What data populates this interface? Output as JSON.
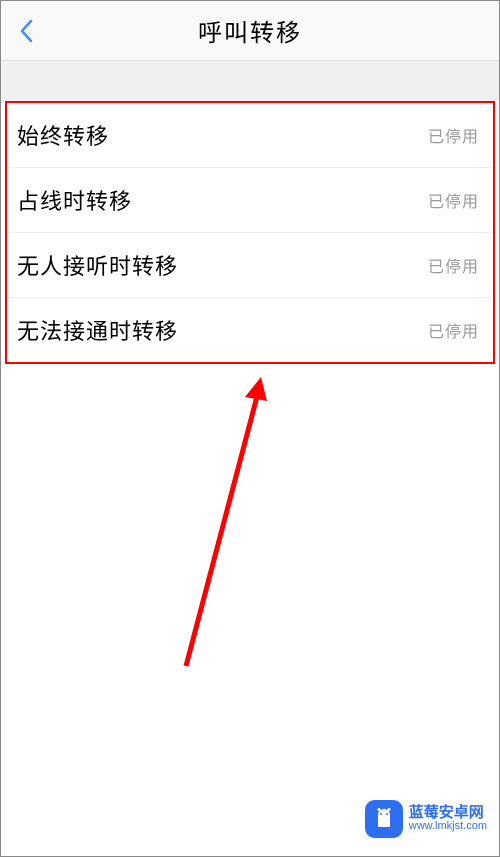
{
  "header": {
    "title": "呼叫转移"
  },
  "options": [
    {
      "label": "始终转移",
      "status": "已停用"
    },
    {
      "label": "占线时转移",
      "status": "已停用"
    },
    {
      "label": "无人接听时转移",
      "status": "已停用"
    },
    {
      "label": "无法接通时转移",
      "status": "已停用"
    }
  ],
  "watermark": {
    "name": "蓝莓安卓网",
    "url": "www.lmkjst.com"
  }
}
